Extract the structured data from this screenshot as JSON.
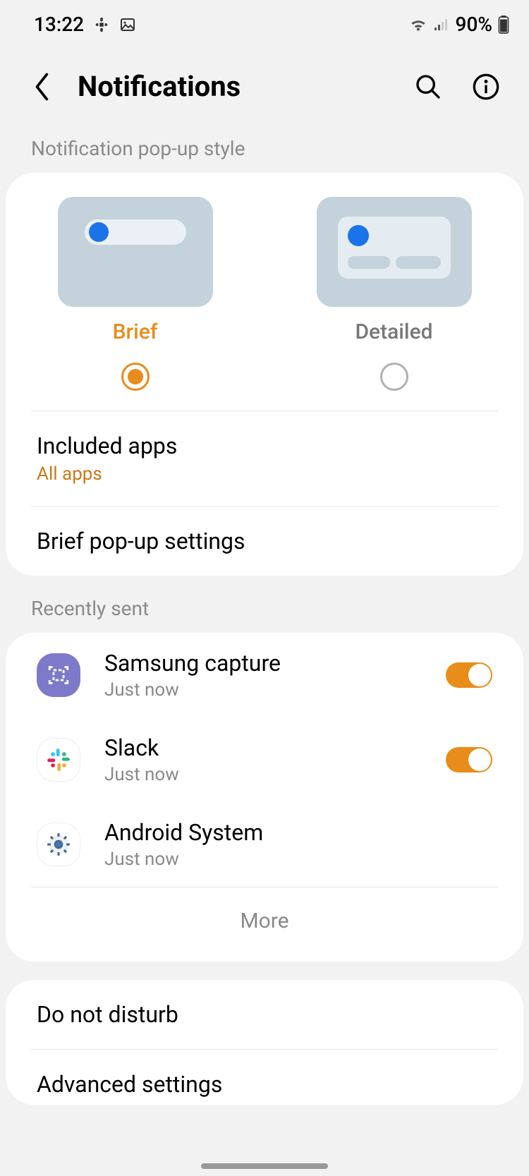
{
  "status": {
    "time": "13:22",
    "battery": "90%"
  },
  "header": {
    "title": "Notifications"
  },
  "sections": {
    "popup_style_label": "Notification pop-up style",
    "recently_sent_label": "Recently sent"
  },
  "popup_styles": {
    "brief": {
      "label": "Brief",
      "selected": true
    },
    "detailed": {
      "label": "Detailed",
      "selected": false
    }
  },
  "settings": {
    "included_apps": {
      "title": "Included apps",
      "subtitle": "All apps"
    },
    "brief_popup": {
      "title": "Brief pop-up settings"
    }
  },
  "recent_apps": [
    {
      "name": "Samsung capture",
      "time": "Just now",
      "toggle": true
    },
    {
      "name": "Slack",
      "time": "Just now",
      "toggle": true
    },
    {
      "name": "Android System",
      "time": "Just now",
      "toggle": null
    }
  ],
  "more_label": "More",
  "bottom_rows": {
    "dnd": "Do not disturb",
    "advanced": "Advanced settings"
  }
}
